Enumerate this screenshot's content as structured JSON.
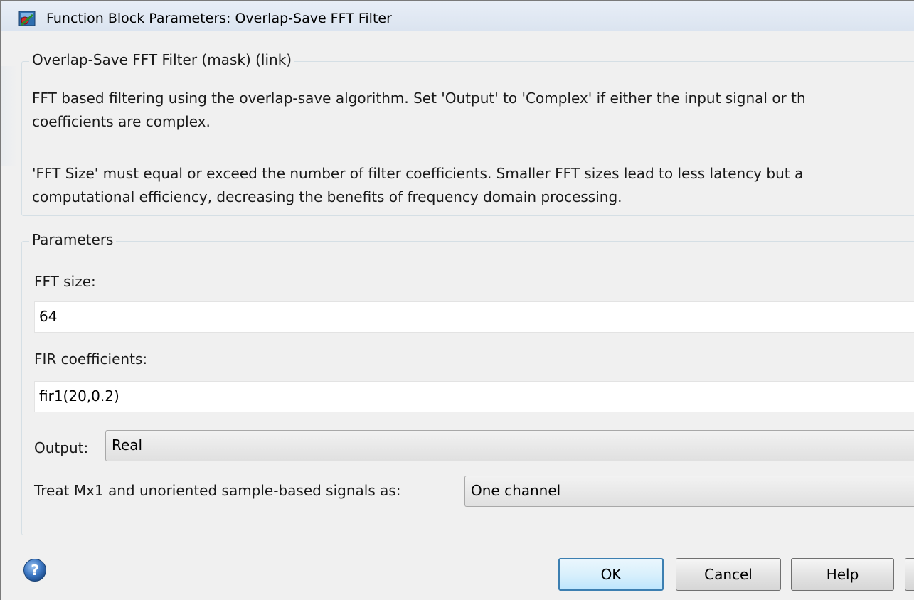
{
  "window": {
    "title": "Function Block Parameters: Overlap-Save FFT Filter"
  },
  "description": {
    "group_label": "Overlap-Save FFT Filter (mask) (link)",
    "lines": [
      "FFT based filtering using the overlap-save algorithm.  Set 'Output' to 'Complex' if either the input signal or th",
      "coefficients are complex.",
      "'FFT Size' must equal or exceed the number of filter coefficients.  Smaller FFT sizes lead to less latency but a",
      "computational efficiency, decreasing the benefits of frequency domain processing."
    ]
  },
  "parameters": {
    "group_label": "Parameters",
    "fft_size": {
      "label": "FFT size:",
      "value": "64"
    },
    "fir_coefficients": {
      "label": "FIR coefficients:",
      "value": "fir1(20,0.2)"
    },
    "output": {
      "label": "Output:",
      "selected": "Real"
    },
    "treat_mx1": {
      "label": "Treat Mx1 and unoriented sample-based signals as:",
      "selected": "One channel"
    }
  },
  "buttons": {
    "ok": "OK",
    "cancel": "Cancel",
    "help": "Help"
  },
  "icons": {
    "app": "simulink-block-icon",
    "help": "help-question-icon"
  },
  "colors": {
    "accent": "#3c7fb1",
    "background": "#f0f0f0"
  }
}
